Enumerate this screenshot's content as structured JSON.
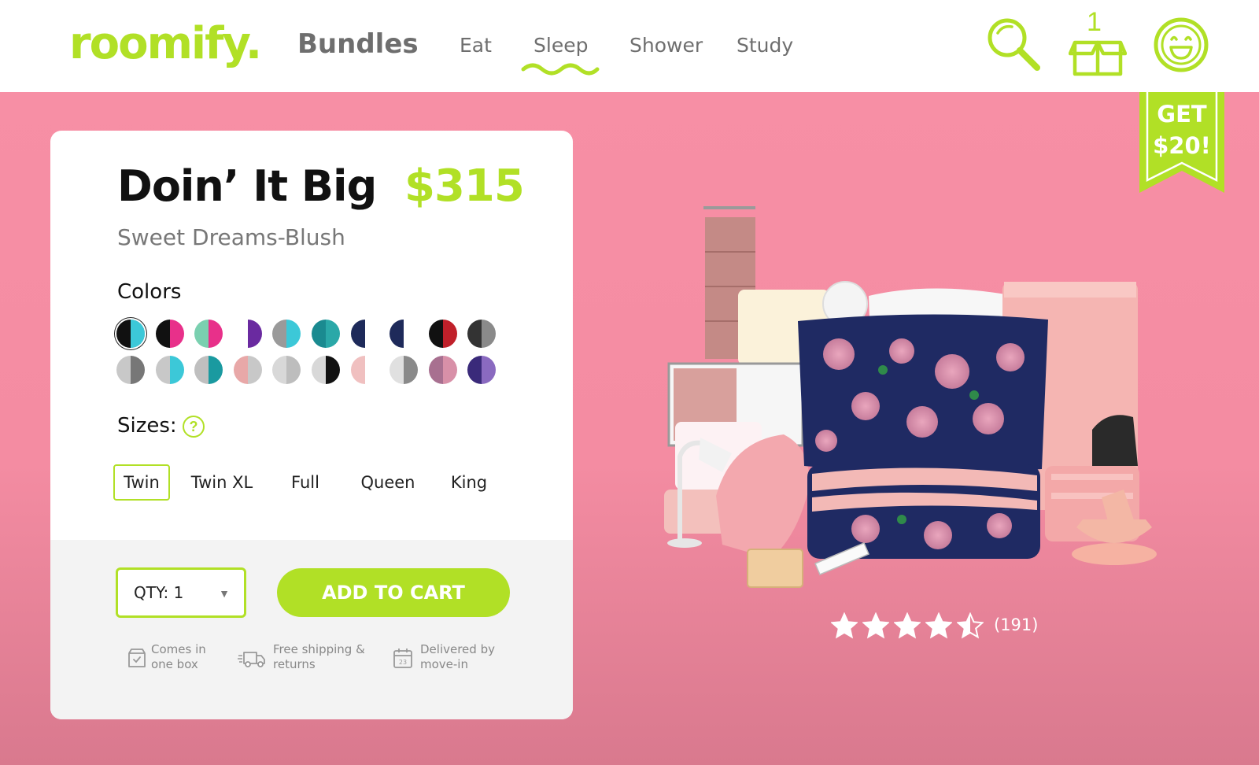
{
  "brand": {
    "logo": "roomify.",
    "accent": "#b1e026"
  },
  "nav": {
    "bundles": "Bundles",
    "items": [
      {
        "label": "Eat"
      },
      {
        "label": "Sleep",
        "active": true
      },
      {
        "label": "Shower"
      },
      {
        "label": "Study"
      }
    ]
  },
  "header_icons": {
    "search": "search-icon",
    "cart": "cart-box-icon",
    "cart_count": "1",
    "account": "smiley-account-icon"
  },
  "promo": {
    "label": "GET $20!",
    "line1": "GET",
    "line2": "$20!"
  },
  "product": {
    "title": "Doin’ It Big",
    "price": "$315",
    "subtitle": "Sweet Dreams-Blush",
    "colors_label": "Colors",
    "colors": [
      {
        "name": "black-white-cyan",
        "c1": "#111111",
        "c2": "#3cc8d8",
        "selected": true
      },
      {
        "name": "black-white-pink",
        "c1": "#111111",
        "c2": "#e8308a"
      },
      {
        "name": "pink-pattern",
        "c1": "#7ad0b0",
        "c2": "#e8308a"
      },
      {
        "name": "purple-floral",
        "c1": "#ffffff",
        "c2": "#6a2aa0"
      },
      {
        "name": "cyan-floral",
        "c1": "#9a9a9a",
        "c2": "#3cc8d8"
      },
      {
        "name": "teal-pattern",
        "c1": "#1a8a90",
        "c2": "#2aa8a8"
      },
      {
        "name": "navy-pattern",
        "c1": "#1e2a5a",
        "c2": "#ffffff"
      },
      {
        "name": "navy-stripe",
        "c1": "#1e2a5a",
        "c2": "#ffffff"
      },
      {
        "name": "black-red-stripe",
        "c1": "#111111",
        "c2": "#c0202a"
      },
      {
        "name": "gray-black-stripe",
        "c1": "#333333",
        "c2": "#8a8a8a"
      },
      {
        "name": "gray-marble",
        "c1": "#c8c8c8",
        "c2": "#777777"
      },
      {
        "name": "gray-cyan",
        "c1": "#c8c8c8",
        "c2": "#3cc8d8"
      },
      {
        "name": "gray-teal",
        "c1": "#bfbfbf",
        "c2": "#1a9aa0"
      },
      {
        "name": "blush-gray",
        "c1": "#e8a8a8",
        "c2": "#c8c8c8"
      },
      {
        "name": "light-gray",
        "c1": "#d8d8d8",
        "c2": "#bdbdbd"
      },
      {
        "name": "white-black",
        "c1": "#d8d8d8",
        "c2": "#111111"
      },
      {
        "name": "blush-white",
        "c1": "#f0c0c0",
        "c2": "#ffffff"
      },
      {
        "name": "gray-white",
        "c1": "#e0e0e0",
        "c2": "#8a8a8a"
      },
      {
        "name": "navy-blush-rose",
        "c1": "#a87090",
        "c2": "#d890a8"
      },
      {
        "name": "navy-purple-floral",
        "c1": "#3a2a7a",
        "c2": "#8a6ac0"
      }
    ],
    "sizes_label": "Sizes:",
    "help_glyph": "?",
    "sizes": [
      {
        "label": "Twin",
        "active": true
      },
      {
        "label": "Twin XL"
      },
      {
        "label": "Full"
      },
      {
        "label": "Queen"
      },
      {
        "label": "King"
      }
    ],
    "qty_label": "QTY: 1",
    "qty_caret": "▼",
    "add_to_cart": "ADD TO CART",
    "features": [
      {
        "icon": "box-check-icon",
        "text": "Comes in\none box"
      },
      {
        "icon": "delivery-truck-icon",
        "text": "Free shipping &\nreturns"
      },
      {
        "icon": "calendar-icon",
        "text": "Delivered by\nmove-in"
      }
    ],
    "rating": {
      "value": 4.5,
      "max": 5,
      "count": "(191)"
    }
  }
}
